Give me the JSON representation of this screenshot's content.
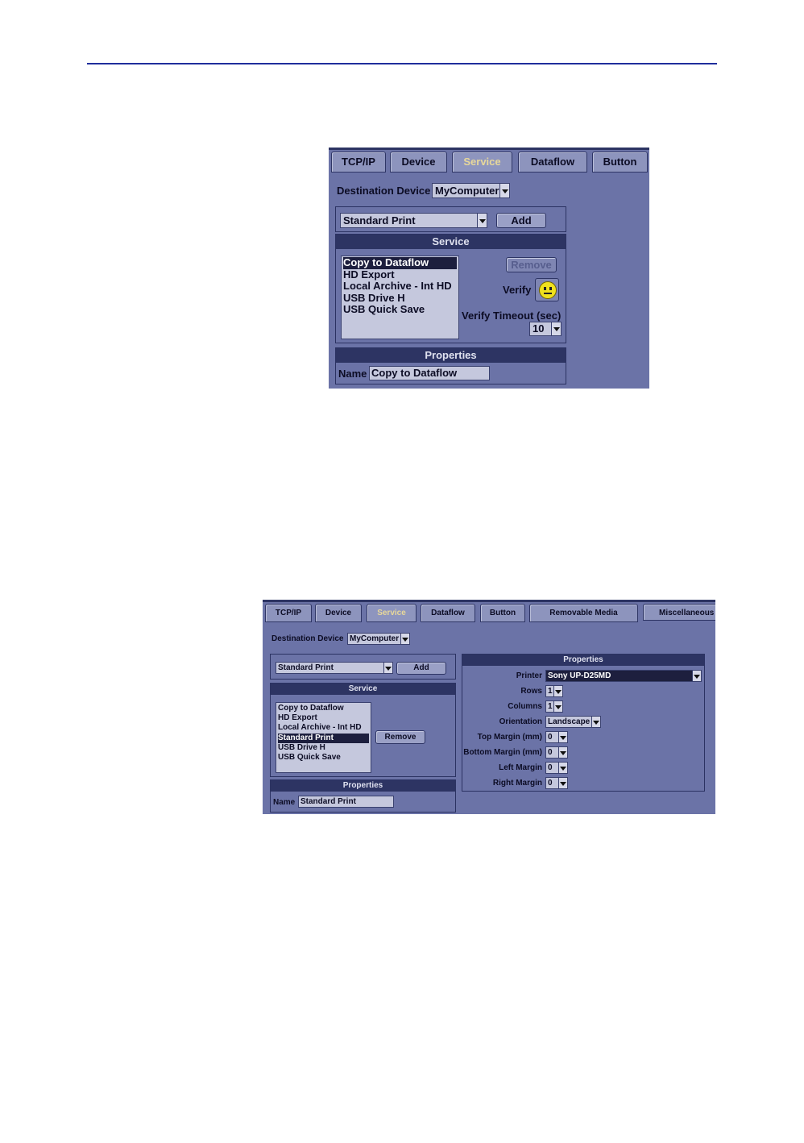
{
  "screen1": {
    "tabs": [
      "TCP/IP",
      "Device",
      "Service",
      "Dataflow",
      "Button"
    ],
    "destination_label": "Destination Device",
    "destination_value": "MyComputer",
    "service_select": "Standard Print",
    "add_label": "Add",
    "service_header": "Service",
    "services": [
      "Copy to Dataflow",
      "HD Export",
      "Local Archive - Int HD",
      "USB Drive H",
      "USB Quick Save"
    ],
    "remove_label": "Remove",
    "verify_label": "Verify",
    "verify_timeout_label": "Verify Timeout (sec)",
    "verify_timeout_value": "10",
    "properties_header": "Properties",
    "name_label": "Name",
    "name_value": "Copy to Dataflow"
  },
  "screen2": {
    "tabs": [
      "TCP/IP",
      "Device",
      "Service",
      "Dataflow",
      "Button",
      "Removable Media",
      "Miscellaneous"
    ],
    "destination_label": "Destination Device",
    "destination_value": "MyComputer",
    "service_select": "Standard Print",
    "add_label": "Add",
    "service_header": "Service",
    "services": [
      "Copy to Dataflow",
      "HD Export",
      "Local Archive - Int HD",
      "Standard Print",
      "USB Drive H",
      "USB Quick Save"
    ],
    "remove_label": "Remove",
    "properties_header": "Properties",
    "name_label": "Name",
    "name_value": "Standard Print",
    "right_properties_header": "Properties",
    "printer_label": "Printer",
    "printer_value": "Sony UP-D25MD",
    "rows_label": "Rows",
    "rows_value": "1",
    "columns_label": "Columns",
    "columns_value": "1",
    "orientation_label": "Orientation",
    "orientation_value": "Landscape",
    "top_margin_label": "Top Margin (mm)",
    "top_margin_value": "0",
    "bottom_margin_label": "Bottom Margin (mm)",
    "bottom_margin_value": "0",
    "left_margin_label": "Left Margin",
    "left_margin_value": "0",
    "right_margin_label": "Right Margin",
    "right_margin_value": "0"
  }
}
